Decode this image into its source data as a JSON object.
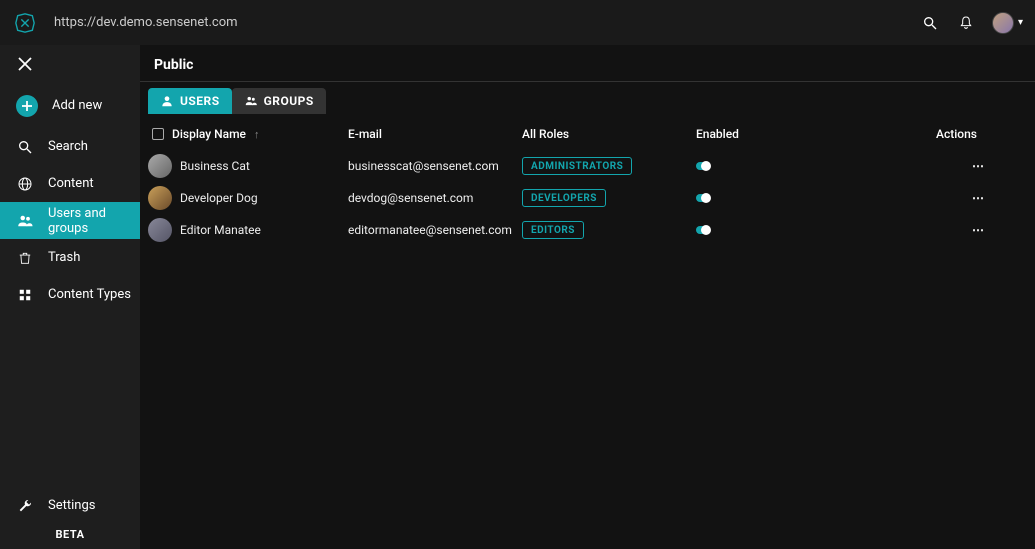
{
  "url": "https://dev.demo.sensenet.com",
  "sidebar": {
    "addnew": "Add new",
    "search": "Search",
    "content": "Content",
    "users": "Users and groups",
    "trash": "Trash",
    "contentTypes": "Content Types",
    "settings": "Settings",
    "beta": "BETA"
  },
  "page": {
    "title": "Public",
    "tabs": {
      "users": "USERS",
      "groups": "GROUPS"
    },
    "columns": {
      "displayName": "Display Name",
      "email": "E-mail",
      "roles": "All Roles",
      "enabled": "Enabled",
      "actions": "Actions"
    },
    "rows": [
      {
        "name": "Business Cat",
        "email": "businesscat@sensenet.com",
        "role": "ADMINISTRATORS"
      },
      {
        "name": "Developer Dog",
        "email": "devdog@sensenet.com",
        "role": "DEVELOPERS"
      },
      {
        "name": "Editor Manatee",
        "email": "editormanatee@sensenet.com",
        "role": "EDITORS"
      }
    ]
  }
}
